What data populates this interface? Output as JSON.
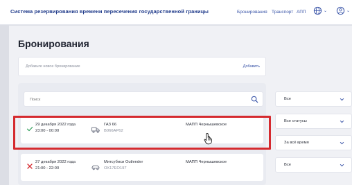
{
  "header": {
    "app_title": "Система резервирования времени пересечения государственной границы",
    "nav": [
      "Бронирования",
      "Транспорт",
      "АПП"
    ],
    "language_icon": "globe-icon",
    "user_icon": "user-icon"
  },
  "page": {
    "title": "Бронирования",
    "add_hint": "Добавьте новое бронирование",
    "add_link": "Добавить"
  },
  "search": {
    "placeholder": "Поиск"
  },
  "bookings": [
    {
      "status": "success",
      "status_icon": "check-icon",
      "date": "29 декабря 2022 года",
      "time": "23:00 - 00:00",
      "vehicle_icon": "truck-icon",
      "model": "ГАЗ 66",
      "plate": "В066АР62",
      "checkpoint": "МАПП Чернышевское"
    },
    {
      "status": "cancelled",
      "status_icon": "cross-icon",
      "date": "27 декабря 2022 года",
      "time": "21:00 - 22:00",
      "vehicle_icon": "car-icon",
      "model": "Митсубиси Outlender",
      "plate": "ОХ17ЕО197",
      "checkpoint": "МАПП Чернышевское"
    }
  ],
  "filters": [
    {
      "value": "Все"
    },
    {
      "value": "Все статусы"
    },
    {
      "value": "За всё время"
    },
    {
      "value": "Все"
    }
  ],
  "colors": {
    "accent": "#3a55a8",
    "highlight": "#d52a2f",
    "success": "#2f9e5a",
    "danger": "#d52a2f"
  }
}
